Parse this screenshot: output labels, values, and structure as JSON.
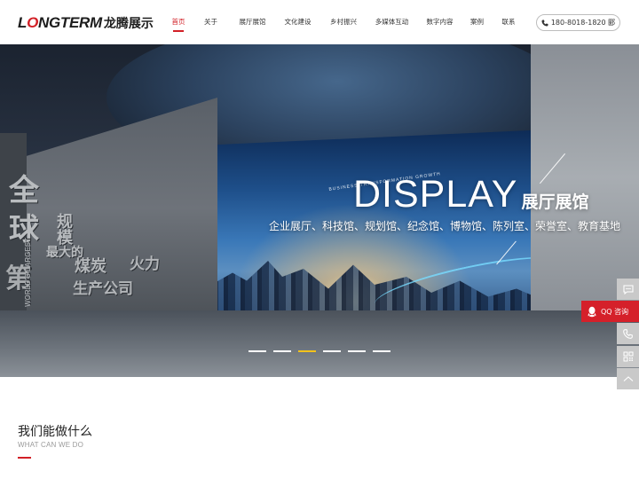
{
  "brand": {
    "logo_en_first": "L",
    "logo_en_highlight": "O",
    "logo_en_rest": "NGTERM",
    "logo_cn": "龙腾展示",
    "accent_color": "#d21f26"
  },
  "nav": {
    "items": [
      {
        "label": "首页",
        "active": true
      },
      {
        "label": "关于",
        "active": false
      },
      {
        "label": "展厅展馆",
        "active": false
      },
      {
        "label": "文化建设",
        "active": false
      },
      {
        "label": "乡村振兴",
        "active": false
      },
      {
        "label": "多媒体互动",
        "active": false
      },
      {
        "label": "数字内容",
        "active": false
      },
      {
        "label": "案例",
        "active": false
      },
      {
        "label": "联系",
        "active": false
      }
    ],
    "phone": "180-8018-1820 郾",
    "phone_icon": "phone-icon"
  },
  "hero": {
    "title_en": "DISPLAY",
    "title_cn": "展厅展馆",
    "subtitle": "企业展厅、科技馆、规划馆、纪念馆、博物馆、陈列室、荣誉室、教育基地",
    "screen_caption": "BUSINESS TRANSFORMATION GROWTH",
    "wall_text": {
      "quan": "全",
      "qiu": "球",
      "di": "第",
      "guimo": "规模",
      "zuida": "最大的",
      "en": "WORLD'S LARGEST",
      "coal": "煤炭",
      "power": "火力",
      "company": "生产公司"
    },
    "slides": 6,
    "active_slide": 3,
    "active_dot_color": "#f2c21a"
  },
  "side_tools": {
    "chat_icon": "chat-icon",
    "qq_label": "QQ 咨询",
    "qq_icon": "qq-icon",
    "phone_icon": "phone-icon",
    "qrcode_icon": "qrcode-icon",
    "top_icon": "back-to-top-icon",
    "qq_color": "#d5202a"
  },
  "section": {
    "title": "我们能做什么",
    "subtitle": "WHAT CAN WE DO"
  }
}
